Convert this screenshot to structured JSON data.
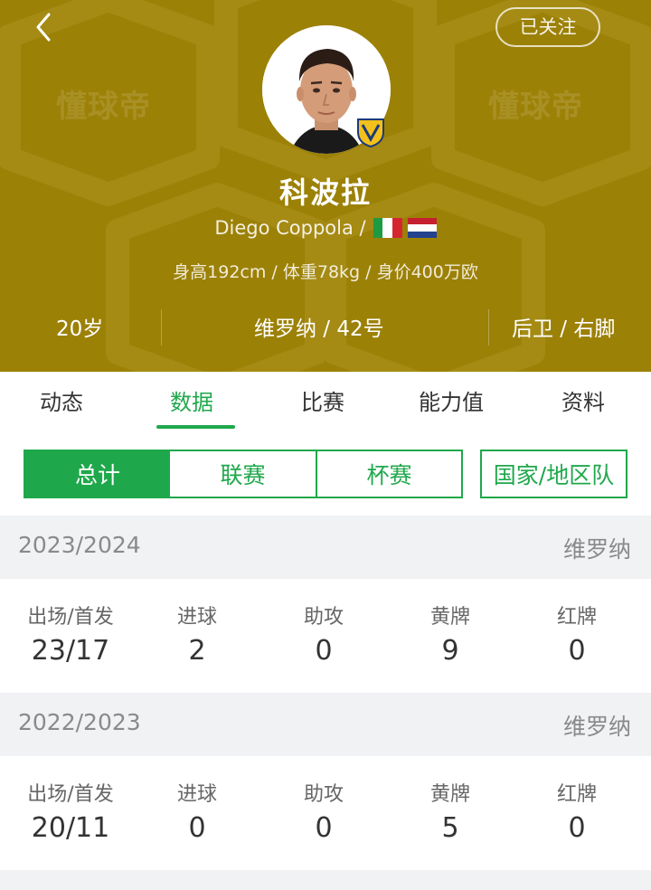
{
  "header": {
    "follow_label": "已关注",
    "player_name": "科波拉",
    "english_name": "Diego Coppola /",
    "body_info": "身高192cm / 体重78kg / 身价400万欧",
    "age": "20岁",
    "club_number": "维罗纳 / 42号",
    "position_foot": "后卫 / 右脚",
    "watermark": "懂球帝",
    "colors": {
      "background": "#9c8107"
    },
    "flags": [
      "italy-flag",
      "netherlands-flag"
    ]
  },
  "tabs": [
    {
      "label": "动态"
    },
    {
      "label": "数据"
    },
    {
      "label": "比赛"
    },
    {
      "label": "能力值"
    },
    {
      "label": "资料"
    }
  ],
  "active_tab": "数据",
  "segments": [
    {
      "label": "总计"
    },
    {
      "label": "联赛"
    },
    {
      "label": "杯赛"
    },
    {
      "label": "国家/地区队"
    }
  ],
  "active_segment": "总计",
  "accent_color": "#1fa84b",
  "seasons": [
    {
      "year": "2023/2024",
      "club": "维罗纳",
      "stats": [
        {
          "label": "出场/首发",
          "value": "23/17"
        },
        {
          "label": "进球",
          "value": "2"
        },
        {
          "label": "助攻",
          "value": "0"
        },
        {
          "label": "黄牌",
          "value": "9"
        },
        {
          "label": "红牌",
          "value": "0"
        }
      ]
    },
    {
      "year": "2022/2023",
      "club": "维罗纳",
      "stats": [
        {
          "label": "出场/首发",
          "value": "20/11"
        },
        {
          "label": "进球",
          "value": "0"
        },
        {
          "label": "助攻",
          "value": "0"
        },
        {
          "label": "黄牌",
          "value": "5"
        },
        {
          "label": "红牌",
          "value": "0"
        }
      ]
    }
  ]
}
